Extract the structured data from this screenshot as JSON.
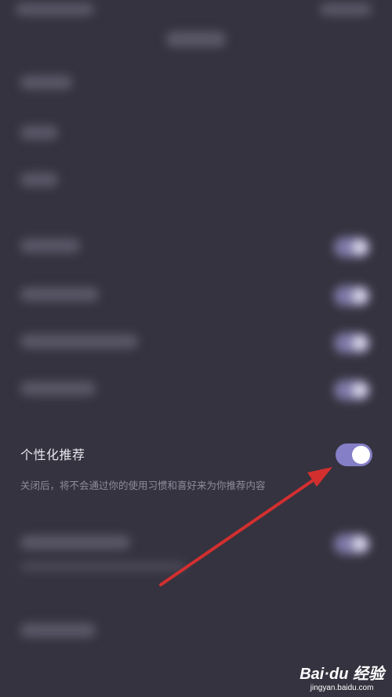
{
  "setting": {
    "title": "个性化推荐",
    "description": "关闭后，将不会通过你的使用习惯和喜好来为你推荐内容",
    "enabled": true
  },
  "colors": {
    "background": "#35333f",
    "toggle_on": "#857fc7",
    "arrow": "#d32f2f"
  },
  "watermark": {
    "logo": "Bai·du 经验",
    "site": "jingyan.baidu.com"
  }
}
